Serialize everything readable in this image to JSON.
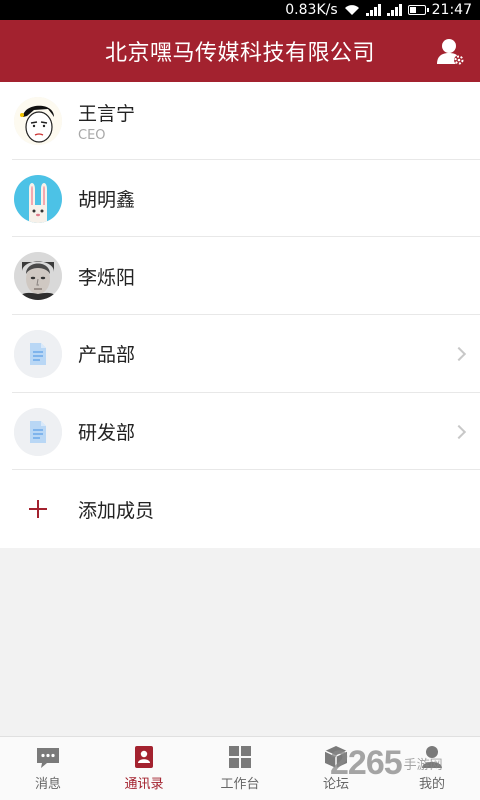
{
  "status_bar": {
    "speed": "0.83K/s",
    "time": "21:47"
  },
  "header": {
    "title": "北京嘿马传媒科技有限公司"
  },
  "contacts": [
    {
      "name": "王言宁",
      "subtitle": "CEO"
    },
    {
      "name": "胡明鑫"
    },
    {
      "name": "李烁阳"
    }
  ],
  "departments": [
    {
      "name": "产品部"
    },
    {
      "name": "研发部"
    }
  ],
  "add_member_label": "添加成员",
  "tabs": [
    {
      "label": "消息",
      "icon": "chat-icon"
    },
    {
      "label": "通讯录",
      "icon": "contacts-icon",
      "active": true
    },
    {
      "label": "工作台",
      "icon": "grid-icon"
    },
    {
      "label": "论坛",
      "icon": "forum-icon"
    },
    {
      "label": "我的",
      "icon": "person-icon"
    }
  ],
  "colors": {
    "accent": "#a3222f",
    "background": "#f2f2f2"
  },
  "watermark": {
    "digits": "2265",
    "text": "手游网"
  }
}
